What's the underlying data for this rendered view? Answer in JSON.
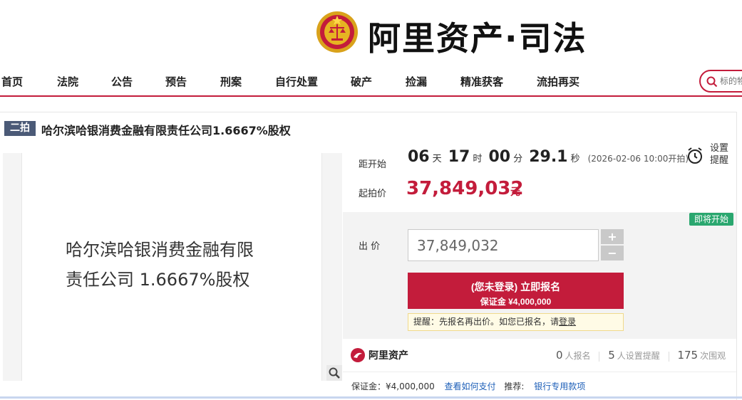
{
  "brand": {
    "title": "阿里资产·司法"
  },
  "nav": {
    "items": [
      "首页",
      "法院",
      "公告",
      "预告",
      "刑案",
      "自行处置",
      "破产",
      "捡漏",
      "精准获客",
      "流拍再买"
    ]
  },
  "search": {
    "placeholder": "标的物"
  },
  "item": {
    "round": "二拍",
    "title": "哈尔滨哈银消费金融有限责任公司1.6667%股权",
    "image_text_line1": "哈尔滨哈银消费金融有限",
    "image_text_line2": "责任公司 1.6667%股权"
  },
  "timer": {
    "label": "距开始",
    "days": "06",
    "days_unit": "天",
    "hours": "17",
    "hours_unit": "时",
    "minutes": "00",
    "minutes_unit": "分",
    "seconds": "29.1",
    "seconds_unit": "秒",
    "start_time": "(2026-02-06 10:00开拍)",
    "remind_label": "设置提醒"
  },
  "price": {
    "label": "起拍价",
    "value": "37,849,032",
    "unit": "元"
  },
  "status_badge": "即将开始",
  "bid": {
    "label": "出 价",
    "value": "37,849,032",
    "plus": "+",
    "minus": "−",
    "signup_line1": "(您未登录) 立即报名",
    "signup_line2": "保证金 ¥4,000,000",
    "tip_text": "提醒：先报名再出价。如您已报名，请",
    "tip_link": "登录"
  },
  "stats": {
    "logo_text": "阿里资产",
    "signups": "0",
    "signups_label": "人报名",
    "reminders": "5",
    "reminders_label": "人设置提醒",
    "views": "175",
    "views_label": "次围观"
  },
  "deposit": {
    "label": "保证金：¥4,000,000",
    "how_to_pay": "查看如何支付",
    "recommend_label": "推荐:",
    "bank_link": "银行专用款项"
  },
  "colors": {
    "brand_red": "#c31c3b",
    "badge_green": "#2aa76f",
    "round_badge": "#4b5a77",
    "link_blue": "#1d5fb8"
  }
}
